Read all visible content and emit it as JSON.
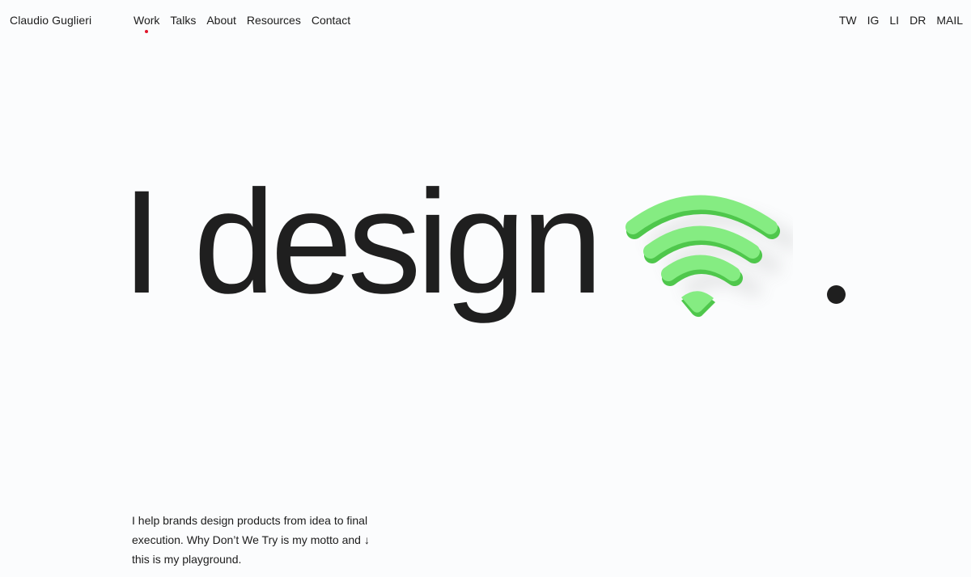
{
  "brand": {
    "name": "Claudio Guglieri"
  },
  "nav": {
    "items": [
      {
        "label": "Work",
        "active": true
      },
      {
        "label": "Talks"
      },
      {
        "label": "About"
      },
      {
        "label": "Resources"
      },
      {
        "label": "Contact"
      }
    ],
    "active_indicator_color": "#e0162b"
  },
  "social": {
    "items": [
      {
        "label": "TW"
      },
      {
        "label": "IG"
      },
      {
        "label": "LI"
      },
      {
        "label": "DR"
      },
      {
        "label": "MAIL"
      }
    ]
  },
  "hero": {
    "headline": "I design",
    "illustration": "wifi-3d-icon",
    "illustration_color": "#7ee87c",
    "period": "."
  },
  "intro": {
    "line1": "I help brands design products from idea to final",
    "line2": "execution. Why Don’t We Try is my motto and",
    "arrow": "↓",
    "line3": "this is my playground."
  },
  "colors": {
    "background": "#fbfcfd",
    "text": "#1c1c1c",
    "accent": "#e0162b"
  }
}
